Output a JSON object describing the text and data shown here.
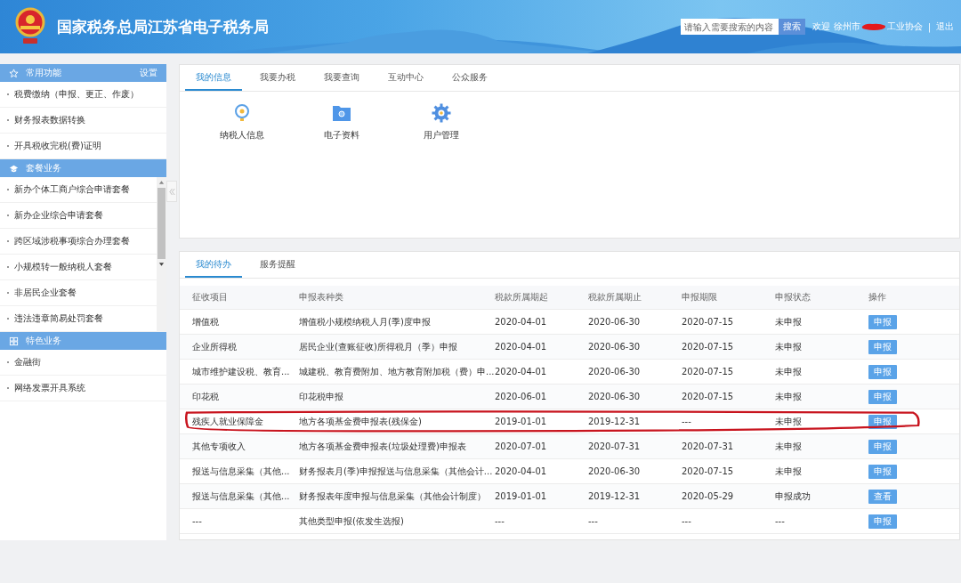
{
  "header": {
    "title": "国家税务总局江苏省电子税务局",
    "search": {
      "placeholder": "请输入需要搜索的内容",
      "button": "搜索"
    },
    "welcome": "欢迎",
    "user_name_start": "徐州市",
    "user_name_end": "工业协会",
    "redacted": true,
    "separator": "|",
    "logout": "退出"
  },
  "sidebar": {
    "sections": [
      {
        "title": "常用功能",
        "action": "设置",
        "scrollable": false,
        "items": [
          "税费缴纳（申报、更正、作废）",
          "财务报表数据转换",
          "开具税收完税(费)证明"
        ]
      },
      {
        "title": "套餐业务",
        "scrollable": true,
        "items": [
          "新办个体工商户综合申请套餐",
          "新办企业综合申请套餐",
          "跨区域涉税事项综合办理套餐",
          "小规模转一般纳税人套餐",
          "非居民企业套餐",
          "违法违章简易处罚套餐"
        ]
      },
      {
        "title": "特色业务",
        "scrollable": false,
        "items": [
          "金融街",
          "网络发票开具系统"
        ]
      }
    ]
  },
  "info_panel": {
    "tabs": [
      {
        "label": "我的信息",
        "selected": true
      },
      {
        "label": "我要办税",
        "selected": false
      },
      {
        "label": "我要查询",
        "selected": false
      },
      {
        "label": "互动中心",
        "selected": false
      },
      {
        "label": "公众服务",
        "selected": false
      }
    ],
    "functions": [
      "纳税人信息",
      "电子资料",
      "用户管理"
    ]
  },
  "todo_panel": {
    "tabs": [
      {
        "label": "我的待办",
        "selected": true
      },
      {
        "label": "服务提醒",
        "selected": false
      }
    ],
    "table": {
      "columns": [
        "征收项目",
        "申报表种类",
        "税款所属期起",
        "税款所属期止",
        "申报期限",
        "申报状态",
        "操作"
      ],
      "rows": [
        {
          "cells": [
            "增值税",
            "增值税小规模纳税人月(季)度申报",
            "2020-04-01",
            "2020-06-30",
            "2020-07-15",
            "未申报"
          ],
          "action": "申报",
          "circled": false
        },
        {
          "cells": [
            "企业所得税",
            "居民企业(查账征收)所得税月（季）申报",
            "2020-04-01",
            "2020-06-30",
            "2020-07-15",
            "未申报"
          ],
          "action": "申报",
          "circled": false
        },
        {
          "cells": [
            "城市维护建设税、教育...",
            "城建税、教育费附加、地方教育附加税（费）申...",
            "2020-04-01",
            "2020-06-30",
            "2020-07-15",
            "未申报"
          ],
          "action": "申报",
          "circled": false
        },
        {
          "cells": [
            "印花税",
            "印花税申报",
            "2020-06-01",
            "2020-06-30",
            "2020-07-15",
            "未申报"
          ],
          "action": "申报",
          "circled": false
        },
        {
          "cells": [
            "残疾人就业保障金",
            "地方各项基金费申报表(残保金)",
            "2019-01-01",
            "2019-12-31",
            "---",
            "未申报"
          ],
          "action": "申报",
          "circled": true
        },
        {
          "cells": [
            "其他专项收入",
            "地方各项基金费申报表(垃圾处理费)申报表",
            "2020-07-01",
            "2020-07-31",
            "2020-07-31",
            "未申报"
          ],
          "action": "申报",
          "circled": false
        },
        {
          "cells": [
            "报送与信息采集（其他...",
            "财务报表月(季)申报报送与信息采集（其他会计...",
            "2020-04-01",
            "2020-06-30",
            "2020-07-15",
            "未申报"
          ],
          "action": "申报",
          "circled": false
        },
        {
          "cells": [
            "报送与信息采集（其他...",
            "财务报表年度申报与信息采集（其他会计制度）",
            "2019-01-01",
            "2019-12-31",
            "2020-05-29",
            "申报成功"
          ],
          "action": "查看",
          "circled": false
        },
        {
          "cells": [
            "---",
            "其他类型申报(依发生选报)",
            "---",
            "---",
            "---",
            "---"
          ],
          "action": "申报",
          "circled": false
        }
      ]
    }
  }
}
